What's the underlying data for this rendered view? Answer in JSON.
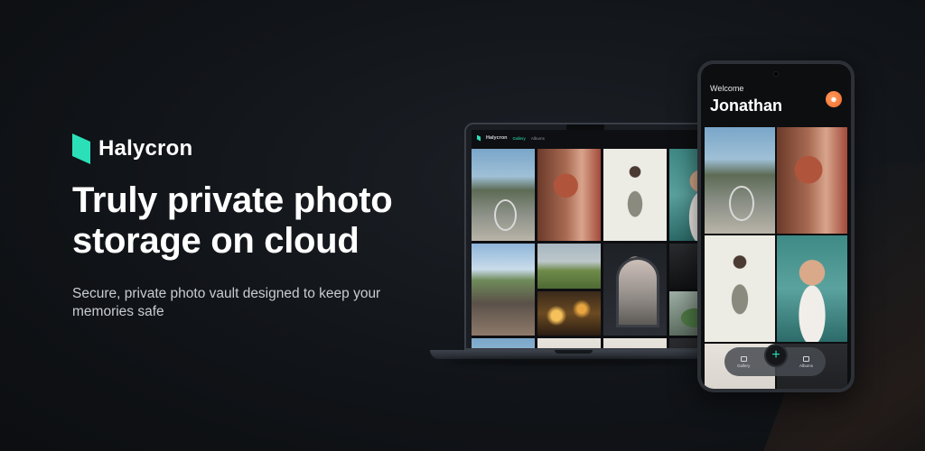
{
  "brand": {
    "name": "Halycron",
    "logo_color": "#2be0b8"
  },
  "hero": {
    "headline": "Truly private photo storage on cloud",
    "subtitle": "Secure, private photo vault designed to keep your memories safe"
  },
  "laptop_app": {
    "name": "Halycron",
    "tabs": [
      {
        "label": "Gallery",
        "active": true
      },
      {
        "label": "Albums",
        "active": false
      }
    ],
    "photos": [
      "street-bicycle",
      "woman-portrait",
      "woman-with-flowers",
      "woman-selfie",
      "city-market",
      "field-landscape",
      "bokeh-lights",
      "archway-bigben",
      "dark-photo",
      "plant",
      "street-partial",
      "room"
    ]
  },
  "phone_app": {
    "welcome": "Welcome",
    "user_name": "Jonathan",
    "avatar_icon": "smiley-icon",
    "photos": [
      "street-bicycle",
      "woman-portrait",
      "woman-with-flowers",
      "woman-selfie"
    ],
    "nav": {
      "gallery_label": "Gallery",
      "albums_label": "Albums",
      "add_icon": "plus-icon"
    }
  },
  "colors": {
    "accent": "#2be0b8",
    "avatar": "#ef6a2b",
    "background": "#111418"
  }
}
